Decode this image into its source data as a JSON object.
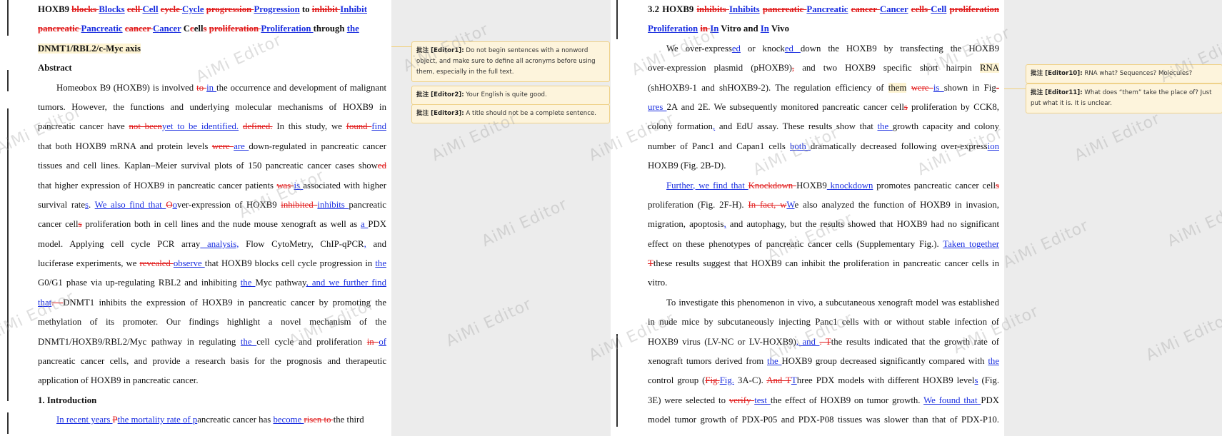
{
  "watermark": "AiMi Editor",
  "left": {
    "lines": [
      [
        {
          "t": "HOXB9 ",
          "c": "b"
        },
        {
          "t": "blocks ",
          "c": "b del"
        },
        {
          "t": "Blocks",
          "c": "b ins"
        },
        {
          "t": " ",
          "c": "b"
        },
        {
          "t": "cell ",
          "c": "b del"
        },
        {
          "t": "Cell",
          "c": "b ins"
        },
        {
          "t": " ",
          "c": "b"
        },
        {
          "t": "cycle ",
          "c": "b del"
        },
        {
          "t": "Cycle",
          "c": "b ins"
        },
        {
          "t": " ",
          "c": "b"
        },
        {
          "t": "progression ",
          "c": "b del"
        },
        {
          "t": "Progression",
          "c": "b ins"
        },
        {
          "t": " to ",
          "c": "b"
        },
        {
          "t": "inhibit ",
          "c": "b del"
        },
        {
          "t": "Inhibit",
          "c": "b ins"
        }
      ],
      [
        {
          "t": "pancreatic ",
          "c": "b del"
        },
        {
          "t": "Pancreatic",
          "c": "b ins"
        },
        {
          "t": " ",
          "c": "b"
        },
        {
          "t": "cancer ",
          "c": "b del"
        },
        {
          "t": "Cancer",
          "c": "b ins"
        },
        {
          "t": " C",
          "c": "b"
        },
        {
          "t": "c",
          "c": "b del"
        },
        {
          "t": "ell",
          "c": "b"
        },
        {
          "t": "s",
          "c": "b del"
        },
        {
          "t": " ",
          "c": "b"
        },
        {
          "t": "proliferation ",
          "c": "b del"
        },
        {
          "t": "Proliferation ",
          "c": "b ins"
        },
        {
          "t": " through ",
          "c": "b"
        },
        {
          "t": "the",
          "c": "b ins"
        }
      ],
      [
        {
          "t": "DNMT1/RBL2/c-Myc axis",
          "c": "b hl"
        }
      ],
      [
        {
          "t": "Abstract",
          "c": "b"
        }
      ],
      [
        {
          "t": "Homeobox B9 (HOXB9) is involved "
        },
        {
          "t": "to ",
          "c": "del"
        },
        {
          "t": "in ",
          "c": "ins"
        },
        {
          "t": "the occurrence and development of malignant"
        }
      ],
      [
        {
          "t": "tumors.   However, the functions and underlying molecular mechanisms of HOXB9 in"
        }
      ],
      [
        {
          "t": "pancreatic cancer have "
        },
        {
          "t": "not been",
          "c": "del"
        },
        {
          "t": "yet to be identified.",
          "c": "ins"
        },
        {
          "t": " "
        },
        {
          "t": "defined.",
          "c": "del"
        },
        {
          "t": "   In this study, we "
        },
        {
          "t": "found ",
          "c": "del"
        },
        {
          "t": "find",
          "c": "ins"
        }
      ],
      [
        {
          "t": "that both HOXB9 mRNA and protein levels "
        },
        {
          "t": "were ",
          "c": "del"
        },
        {
          "t": "are ",
          "c": "ins"
        },
        {
          "t": "down-regulated in pancreatic cancer"
        }
      ],
      [
        {
          "t": "tissues and cell lines.   Kaplan–Meier survival plots of 150 pancreatic cancer cases show"
        },
        {
          "t": "ed",
          "c": "del"
        }
      ],
      [
        {
          "t": "that higher expression of HOXB9 in pancreatic cancer patients "
        },
        {
          "t": "was ",
          "c": "del"
        },
        {
          "t": "is ",
          "c": "ins"
        },
        {
          "t": "associated with higher"
        }
      ],
      [
        {
          "t": "survival rate"
        },
        {
          "t": "s",
          "c": "ins"
        },
        {
          "t": ".   "
        },
        {
          "t": "We also find that ",
          "c": "ins"
        },
        {
          "t": "O",
          "c": "del"
        },
        {
          "t": "o",
          "c": "ins"
        },
        {
          "t": "ver-expression of HOXB9 "
        },
        {
          "t": "inhibited ",
          "c": "del"
        },
        {
          "t": "inhibits ",
          "c": "ins"
        },
        {
          "t": "pancreatic"
        }
      ],
      [
        {
          "t": "cancer cell"
        },
        {
          "t": "s",
          "c": "del"
        },
        {
          "t": " proliferation both in cell lines and the nude mouse xenograft as well as "
        },
        {
          "t": "a ",
          "c": "ins"
        },
        {
          "t": "PDX"
        }
      ],
      [
        {
          "t": "model.   Applying cell cycle PCR array"
        },
        {
          "t": " analysis,",
          "c": "ins"
        },
        {
          "t": " Flow CytoMetry, ChIP-qPCR"
        },
        {
          "t": ",",
          "c": "ins"
        },
        {
          "t": " and"
        }
      ],
      [
        {
          "t": "luciferase experiments, we "
        },
        {
          "t": "revealed ",
          "c": "del"
        },
        {
          "t": "observe ",
          "c": "ins"
        },
        {
          "t": "that HOXB9 blocks cell cycle progression in "
        },
        {
          "t": "the",
          "c": "ins"
        }
      ],
      [
        {
          "t": "G0/G1 phase via up-regulating RBL2 and inhibiting "
        },
        {
          "t": "the ",
          "c": "ins"
        },
        {
          "t": "Myc pathway"
        },
        {
          "t": ", and we further find",
          "c": "ins"
        }
      ],
      [
        {
          "t": "that",
          "c": "ins"
        },
        {
          "t": ". ",
          "c": "del"
        },
        {
          "t": " "
        },
        {
          "t": "–",
          "c": "del"
        },
        {
          "t": "DNMT1 inhibits the expression of HOXB9 in pancreatic cancer by promoting the"
        }
      ],
      [
        {
          "t": "methylation of its promoter.   Our findings highlight a novel mechanism of the"
        }
      ],
      [
        {
          "t": "DNMT1/HOXB9/RBL2/Myc pathway in regulating "
        },
        {
          "t": "the ",
          "c": "ins"
        },
        {
          "t": "cell cycle and proliferation "
        },
        {
          "t": "in ",
          "c": "del"
        },
        {
          "t": "of",
          "c": "ins"
        }
      ],
      [
        {
          "t": "pancreatic cancer cells, and provide a research basis for the prognosis and therapeutic"
        }
      ],
      [
        {
          "t": "application of HOXB9 in pancreatic cancer."
        }
      ],
      [
        {
          "t": "1. Introduction",
          "c": "b"
        }
      ],
      [
        {
          "t": "In recent years ",
          "c": "ins"
        },
        {
          "t": "P",
          "c": "del"
        },
        {
          "t": "the mortality rate of p",
          "c": "ins"
        },
        {
          "t": "ancreatic cancer has "
        },
        {
          "t": "become ",
          "c": "ins"
        },
        {
          "t": "risen to ",
          "c": "del"
        },
        {
          "t": "the third"
        }
      ]
    ]
  },
  "right": {
    "lines": [
      [
        {
          "t": "3.2 HOXB9 ",
          "c": "b"
        },
        {
          "t": "inhibits ",
          "c": "b del"
        },
        {
          "t": "Inhibits",
          "c": "b ins"
        },
        {
          "t": " ",
          "c": "b"
        },
        {
          "t": "pancreatic ",
          "c": "b del"
        },
        {
          "t": "Pancreatic",
          "c": "b ins"
        },
        {
          "t": " ",
          "c": "b"
        },
        {
          "t": "cancer ",
          "c": "b del"
        },
        {
          "t": "Cancer",
          "c": "b ins"
        },
        {
          "t": " ",
          "c": "b"
        },
        {
          "t": "cells ",
          "c": "b del"
        },
        {
          "t": "Cell",
          "c": "b ins"
        },
        {
          "t": " ",
          "c": "b"
        },
        {
          "t": "proliferation",
          "c": "b del"
        }
      ],
      [
        {
          "t": "Proliferation",
          "c": "b ins"
        },
        {
          "t": " ",
          "c": "b"
        },
        {
          "t": "in ",
          "c": "b del"
        },
        {
          "t": "In",
          "c": "b ins"
        },
        {
          "t": " Vitro and ",
          "c": "b"
        },
        {
          "t": "In",
          "c": "b ins"
        },
        {
          "t": " Vivo",
          "c": "b"
        }
      ],
      [
        {
          "t": "We over-express"
        },
        {
          "t": "ed",
          "c": "ins"
        },
        {
          "t": " or knock"
        },
        {
          "t": "ed ",
          "c": "ins"
        },
        {
          "t": "down the HOXB9 by transfecting the HOXB9"
        }
      ],
      [
        {
          "t": "over-expression plasmid (pHOXB9)"
        },
        {
          "t": ",",
          "c": "del"
        },
        {
          "t": " and two HOXB9 specific short hairpin "
        },
        {
          "t": "RNA",
          "c": "hl"
        }
      ],
      [
        {
          "t": "(shHOXB9-1 and shHOXB9-2).   The regulation efficiency of "
        },
        {
          "t": "them",
          "c": "hl"
        },
        {
          "t": " "
        },
        {
          "t": "were ",
          "c": "del"
        },
        {
          "t": "is ",
          "c": "ins"
        },
        {
          "t": "shown in Fig"
        },
        {
          "t": "-",
          "c": "del"
        }
      ],
      [
        {
          "t": "ures ",
          "c": "ins"
        },
        {
          "t": "2A and 2E.   We subsequently monitored pancreatic cancer cell"
        },
        {
          "t": "s",
          "c": "del"
        },
        {
          "t": " proliferation by CCK8,"
        }
      ],
      [
        {
          "t": "colony formation"
        },
        {
          "t": ",",
          "c": "ins"
        },
        {
          "t": " and EdU assay.   These results show that "
        },
        {
          "t": "the ",
          "c": "ins"
        },
        {
          "t": "growth capacity and colony"
        }
      ],
      [
        {
          "t": "number of Panc1 and Capan1 cells "
        },
        {
          "t": "both ",
          "c": "ins"
        },
        {
          "t": "dramatically decreased following over-express"
        },
        {
          "t": "ion",
          "c": "ins"
        }
      ],
      [
        {
          "t": "HOXB9 (Fig. 2B-D)."
        }
      ],
      [
        {
          "t": "Further, we find that ",
          "c": "ins"
        },
        {
          "t": "Knockdown ",
          "c": "del"
        },
        {
          "t": "HOXB9"
        },
        {
          "t": " knockdown",
          "c": "ins"
        },
        {
          "t": " promotes pancreatic cancer cell"
        },
        {
          "t": "s",
          "c": "del"
        }
      ],
      [
        {
          "t": "proliferation (Fig. 2F-H).   "
        },
        {
          "t": "In fact, w",
          "c": "del"
        },
        {
          "t": "W",
          "c": "ins"
        },
        {
          "t": "e also analyzed the function of HOXB9 in invasion,"
        }
      ],
      [
        {
          "t": "migration, apoptosis"
        },
        {
          "t": ",",
          "c": "ins"
        },
        {
          "t": " and autophagy, but the results showed that HOXB9 had no significant"
        }
      ],
      [
        {
          "t": "effect on these phenotypes of pancreatic cancer cells (Supplementary Fig.).   "
        },
        {
          "t": "Taken together",
          "c": "ins"
        }
      ],
      [
        {
          "t": "T",
          "c": "del"
        },
        {
          "t": "these results suggest that HOXB9 can inhibit the proliferation in pancreatic cancer cells in"
        }
      ],
      [
        {
          "t": "vitro."
        }
      ],
      [
        {
          "t": "To investigate this phenomenon in vivo, a subcutaneous xenograft model was established"
        }
      ],
      [
        {
          "t": "in nude mice by subcutaneously injecting Panc1 cells with or without stable infection of"
        }
      ],
      [
        {
          "t": "HOXB9 virus (LV-NC or LV-HOXB9)"
        },
        {
          "t": ", and ",
          "c": "ins"
        },
        {
          "t": " . T",
          "c": "del"
        },
        {
          "t": "the results indicated that the growth rate of"
        }
      ],
      [
        {
          "t": "xenograft tumors derived from "
        },
        {
          "t": "the ",
          "c": "ins"
        },
        {
          "t": "HOXB9 group decreased significantly compared with "
        },
        {
          "t": "the",
          "c": "ins"
        }
      ],
      [
        {
          "t": "control group ("
        },
        {
          "t": "Fig.",
          "c": "del"
        },
        {
          "t": "Fig.",
          "c": "ins"
        },
        {
          "t": "  3A-C).   "
        },
        {
          "t": "And T",
          "c": "del"
        },
        {
          "t": "T",
          "c": "ins"
        },
        {
          "t": "hree PDX models with different HOXB9 level"
        },
        {
          "t": "s",
          "c": "ins"
        },
        {
          "t": " (Fig."
        }
      ],
      [
        {
          "t": "3E) were selected to "
        },
        {
          "t": "verify ",
          "c": "del"
        },
        {
          "t": "test ",
          "c": "ins"
        },
        {
          "t": "the effect of HOXB9 on tumor growth.   "
        },
        {
          "t": "We found that ",
          "c": "ins"
        },
        {
          "t": "PDX"
        }
      ],
      [
        {
          "t": "model tumor growth of PDX-P05 and PDX-P08 tissues was slower than that of PDX-P10."
        }
      ]
    ]
  },
  "comments": [
    {
      "id": "editor1",
      "label": "批注 [Editor1]:",
      "text": "Do not begin sentences with a nonword object, and make sure to define all acronyms before using them, especially in the full text."
    },
    {
      "id": "editor2",
      "label": "批注 [Editor2]:",
      "text": "Your English is quite good."
    },
    {
      "id": "editor3",
      "label": "批注 [Editor3]:",
      "text": "A title should not be a complete sentence."
    },
    {
      "id": "editor10",
      "label": "批注 [Editor10]:",
      "text": "RNA what? Sequences?    Molecules?"
    },
    {
      "id": "editor11",
      "label": "批注 [Editor11]:",
      "text": "What does “them” take the place of?    Just put what it is.    It is unclear."
    }
  ]
}
